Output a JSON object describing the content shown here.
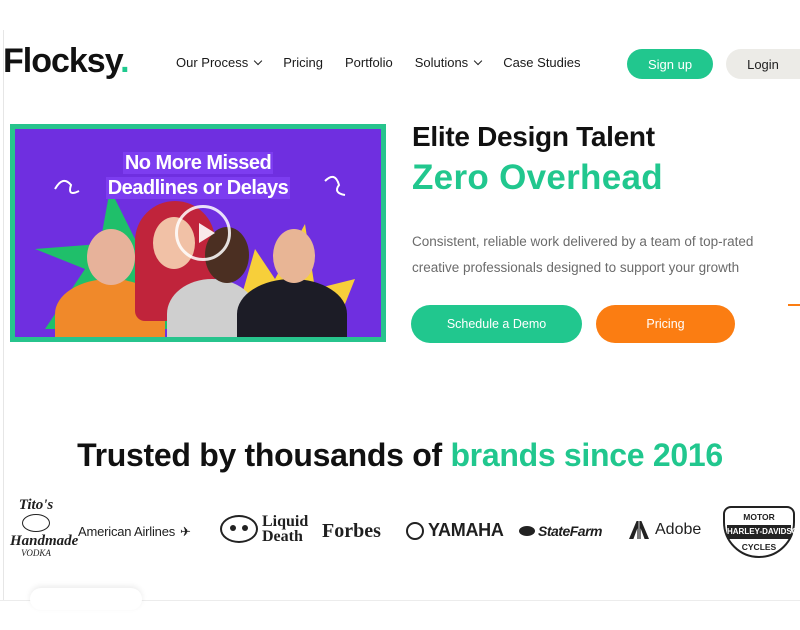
{
  "nav": {
    "logo_text": "Flocksy",
    "logo_dot": ".",
    "items": [
      {
        "label": "Our Process",
        "has_dropdown": true
      },
      {
        "label": "Pricing",
        "has_dropdown": false
      },
      {
        "label": "Portfolio",
        "has_dropdown": false
      },
      {
        "label": "Solutions",
        "has_dropdown": true
      },
      {
        "label": "Case Studies",
        "has_dropdown": false
      }
    ],
    "signup_label": "Sign up",
    "login_label": "Login"
  },
  "video": {
    "title_line1": "No More Missed",
    "title_line2": "Deadlines or Delays"
  },
  "hero": {
    "title": "Elite Design Talent",
    "subtitle": "Zero Overhead",
    "description": "Consistent, reliable work delivered by a team of top-rated creative professionals designed to support your growth",
    "primary_cta": "Schedule a Demo",
    "secondary_cta": "Pricing"
  },
  "trusted": {
    "lead": "Trusted by thousands of ",
    "accent": "brands since 2016"
  },
  "logos": {
    "titos_top": "Tito's",
    "titos_bottom": "Handmade",
    "titos_vodka": "VODKA",
    "american_airlines": "American Airlines",
    "liquid_death_1": "Liquid",
    "liquid_death_2": "Death",
    "forbes": "Forbes",
    "yamaha": "YAMAHA",
    "state_farm": "StateFarm",
    "adobe": "Adobe",
    "harley_top": "MOTOR",
    "harley_mid": "HARLEY-DAVIDSON",
    "harley_bottom": "CYCLES"
  },
  "colors": {
    "brand_green": "#21c78e",
    "brand_orange": "#fb7d12",
    "video_purple": "#6f2fe0"
  }
}
